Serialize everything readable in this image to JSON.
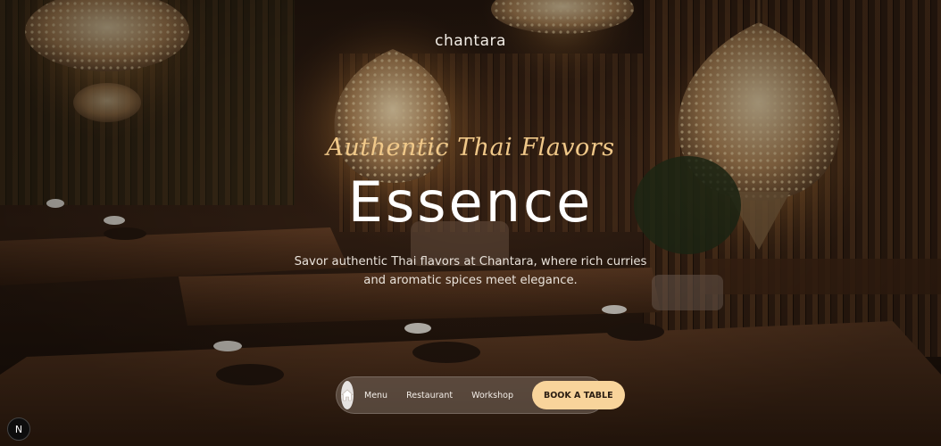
{
  "header": {
    "logo": "chantara"
  },
  "hero": {
    "tagline": "Authentic Thai Flavors",
    "headline": "Essence",
    "description": "Savor authentic Thai flavors at Chantara, where rich curries and aromatic spices meet elegance."
  },
  "nav": {
    "home_icon": "home-icon",
    "items": [
      {
        "label": "Menu"
      },
      {
        "label": "Restaurant"
      },
      {
        "label": "Workshop"
      }
    ],
    "cta": "BOOK A TABLE"
  },
  "badge": {
    "label": "N"
  },
  "colors": {
    "accent": "#f8d49b",
    "tagline": "#f0c889",
    "background": "#1a100a"
  }
}
